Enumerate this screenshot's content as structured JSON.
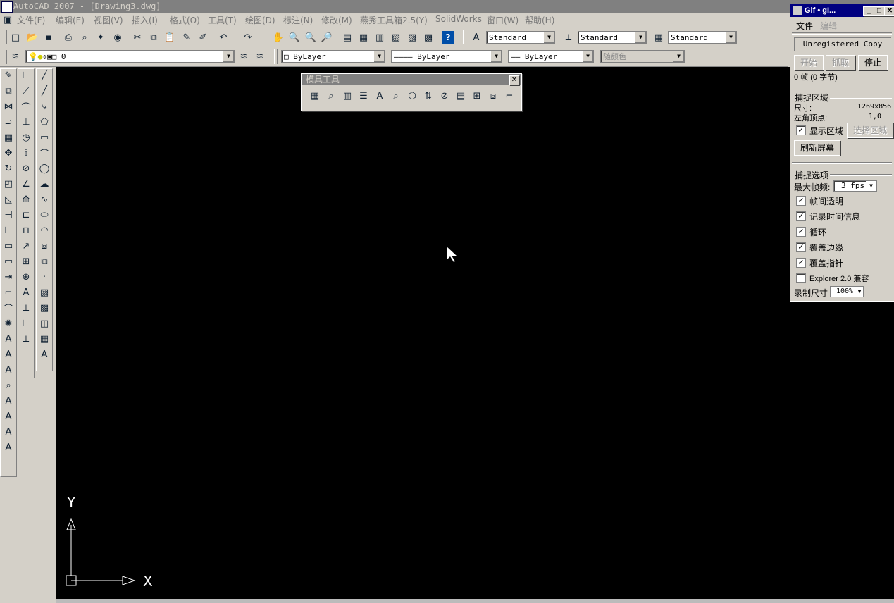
{
  "window": {
    "title": "AutoCAD 2007 - [Drawing3.dwg]"
  },
  "menu": [
    "文件(F)",
    "编辑(E)",
    "视图(V)",
    "插入(I)",
    "格式(O)",
    "工具(T)",
    "绘图(D)",
    "标注(N)",
    "修改(M)",
    "燕秀工具箱2.5(Y)",
    "SolidWorks",
    "窗口(W)",
    "帮助(H)"
  ],
  "toolbar": {
    "text_style": "Standard",
    "dim_style": "Standard",
    "table_style": "Standard",
    "layer": "0",
    "color": "ByLayer",
    "linetype": "ByLayer",
    "lineweight": "ByLayer",
    "plotstyle": "随颜色"
  },
  "float_panel": {
    "title": "模具工具"
  },
  "ucs": {
    "y_label": "Y",
    "x_label": "X"
  },
  "gif_panel": {
    "title": "Gif • gI...",
    "menu_file": "文件",
    "menu_edit": "编辑",
    "license": "Unregistered Copy",
    "btn_start": "开始",
    "btn_capture": "抓取",
    "btn_stop": "停止",
    "frames": "0 帧 (0 字节)",
    "capture_area_header": "捕捉区域",
    "size_label": "尺寸:",
    "size_value": "1269x856",
    "corner_label": "左角顶点:",
    "corner_value": "1,0",
    "show_area": "显示区域",
    "select_area": "选择区域",
    "refresh": "刷新屏幕",
    "capture_opts_header": "捕捉选项",
    "max_fps_label": "最大帧频:",
    "max_fps": "3 fps",
    "opt_transparent": "帧间透明",
    "opt_time": "记录时间信息",
    "opt_loop": "循环",
    "opt_edge": "覆盖边缘",
    "opt_pointer": "覆盖指针",
    "opt_explorer": "Explorer 2.0 兼容",
    "rec_size_label": "录制尺寸",
    "rec_size": "100%"
  }
}
